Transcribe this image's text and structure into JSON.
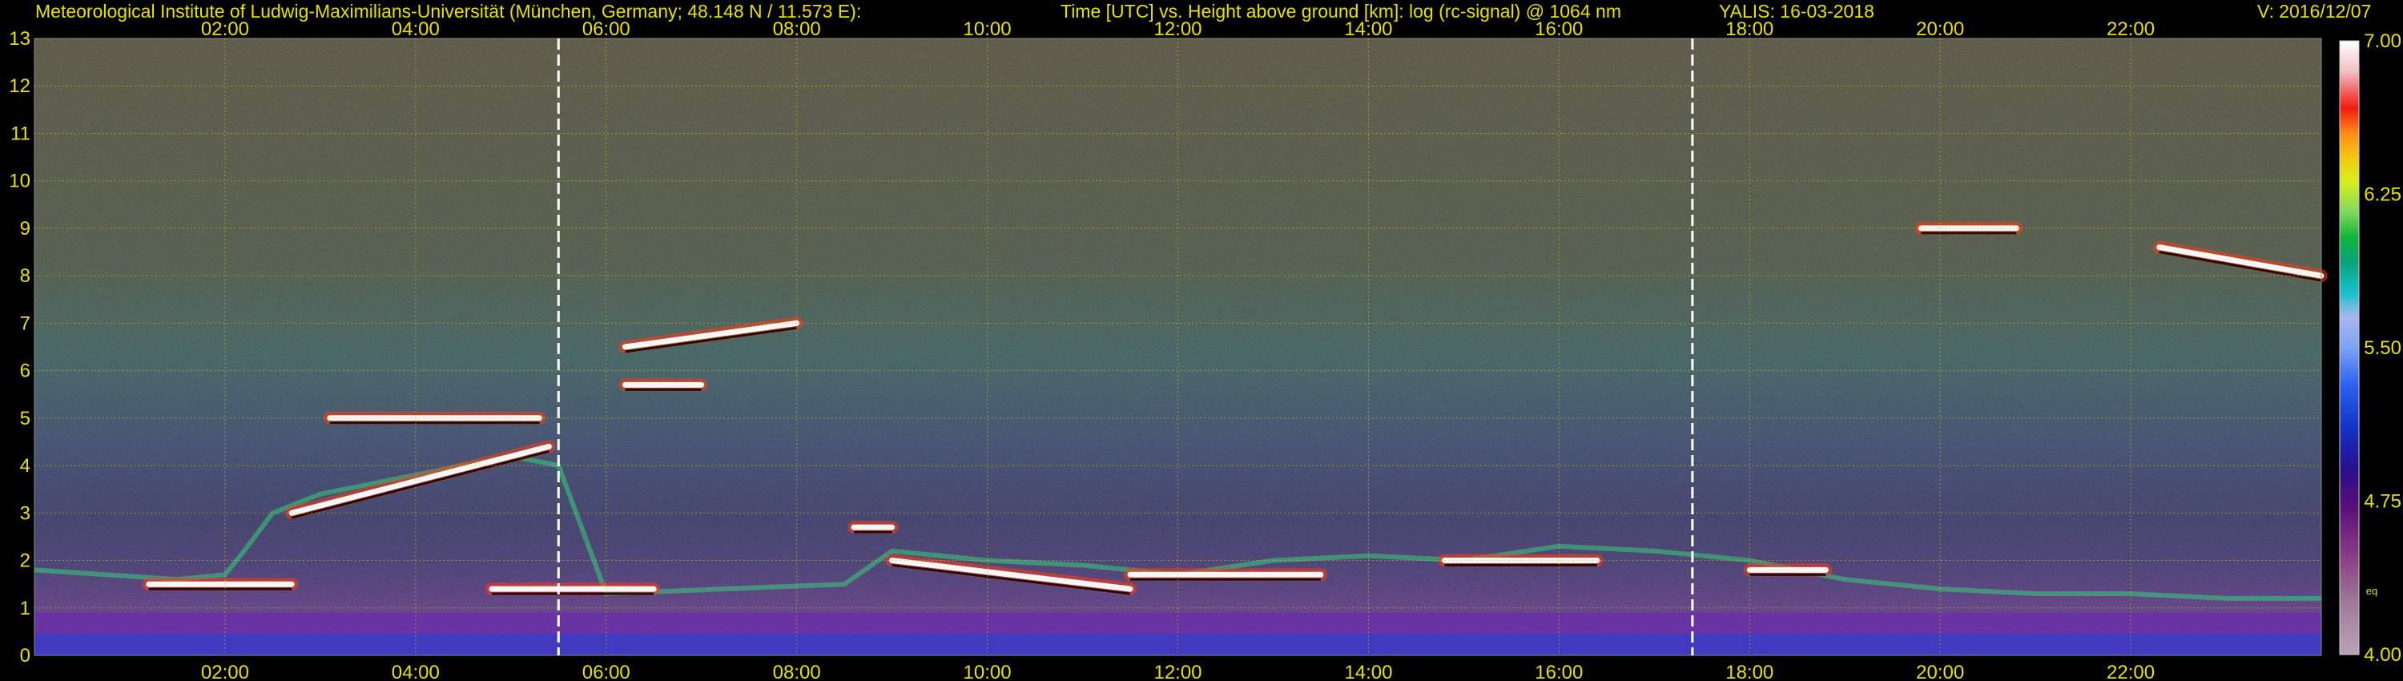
{
  "header": {
    "institute": "Meteorological Institute of Ludwig-Maximilians-Universität (München, Germany; 48.148 N / 11.573 E):",
    "description": "Time [UTC] vs. Height above ground [km]: log (rc-signal) @ 1064 nm",
    "instrument_date": "YALIS: 16-03-2018",
    "version": "V: 2016/12/07"
  },
  "colors": {
    "header_text": "#e8e000",
    "axis_text": "#e8e000",
    "grid": "#c8c800",
    "background": "#000000",
    "marker_line": "#ffffff"
  },
  "chart_data": {
    "type": "heatmap",
    "title": "Time [UTC] vs. Height above ground [km]: log (rc-signal) @ 1064 nm",
    "xlabel": "",
    "ylabel": "",
    "x_range_hours": [
      0.0,
      24.0
    ],
    "x_ticks": [
      "02:00",
      "04:00",
      "06:00",
      "08:00",
      "10:00",
      "12:00",
      "14:00",
      "16:00",
      "18:00",
      "20:00",
      "22:00"
    ],
    "x_tick_hours": [
      2,
      4,
      6,
      8,
      10,
      12,
      14,
      16,
      18,
      20,
      22
    ],
    "y_range_km": [
      0,
      13
    ],
    "y_ticks": [
      "0",
      "1",
      "2",
      "3",
      "4",
      "5",
      "6",
      "7",
      "8",
      "9",
      "10",
      "11",
      "12",
      "13"
    ],
    "grid": true,
    "marker_lines_hours": [
      5.5,
      17.4
    ],
    "colorbar": {
      "range": [
        4.0,
        7.0
      ],
      "ticks": [
        "7.00",
        "6.25",
        "5.50",
        "4.75",
        "4.00"
      ],
      "tick_values": [
        7.0,
        6.25,
        5.5,
        4.75,
        4.0
      ],
      "note": "eq"
    },
    "features": {
      "boundary_layer_top_km": [
        [
          0.0,
          1.8
        ],
        [
          1.5,
          1.6
        ],
        [
          2.0,
          1.7
        ],
        [
          2.2,
          2.2
        ],
        [
          2.5,
          3.0
        ],
        [
          3.0,
          3.4
        ],
        [
          3.5,
          3.6
        ],
        [
          4.0,
          3.8
        ],
        [
          4.5,
          4.0
        ],
        [
          5.0,
          4.2
        ],
        [
          5.5,
          4.0
        ],
        [
          6.0,
          1.3
        ],
        [
          8.5,
          1.5
        ],
        [
          9.0,
          2.2
        ],
        [
          10.0,
          2.0
        ],
        [
          11.0,
          1.9
        ],
        [
          12.0,
          1.7
        ],
        [
          13.0,
          2.0
        ],
        [
          14.0,
          2.1
        ],
        [
          15.0,
          2.0
        ],
        [
          16.0,
          2.3
        ],
        [
          17.0,
          2.2
        ],
        [
          18.0,
          2.0
        ],
        [
          19.0,
          1.6
        ],
        [
          20.0,
          1.4
        ],
        [
          21.0,
          1.3
        ],
        [
          22.0,
          1.3
        ],
        [
          23.0,
          1.2
        ],
        [
          24.0,
          1.2
        ]
      ],
      "cloud_layers": [
        {
          "x_start": 1.2,
          "x_end": 2.7,
          "y": 1.5
        },
        {
          "x_start": 2.7,
          "x_end": 5.4,
          "y_start": 3.0,
          "y_end": 4.4
        },
        {
          "x_start": 3.1,
          "x_end": 5.3,
          "y": 5.0
        },
        {
          "x_start": 4.8,
          "x_end": 6.5,
          "y": 1.4
        },
        {
          "x_start": 6.2,
          "x_end": 8.0,
          "y_start": 6.5,
          "y_end": 7.0
        },
        {
          "x_start": 6.2,
          "x_end": 7.0,
          "y": 5.7
        },
        {
          "x_start": 8.6,
          "x_end": 9.0,
          "y": 2.7
        },
        {
          "x_start": 9.0,
          "x_end": 11.5,
          "y_start": 2.0,
          "y_end": 1.4
        },
        {
          "x_start": 11.5,
          "x_end": 13.5,
          "y": 1.7
        },
        {
          "x_start": 14.8,
          "x_end": 16.4,
          "y": 2.0
        },
        {
          "x_start": 18.0,
          "x_end": 18.8,
          "y": 1.8
        },
        {
          "x_start": 19.8,
          "x_end": 20.8,
          "y": 9.0
        },
        {
          "x_start": 22.3,
          "x_end": 24.0,
          "y_start": 8.6,
          "y_end": 8.0
        }
      ]
    }
  }
}
